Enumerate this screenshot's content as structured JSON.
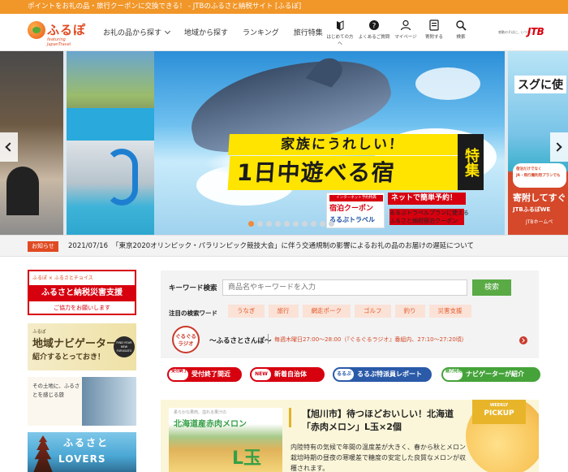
{
  "topbar": {
    "text": "ポイントをお礼の品・旅行クーポンに交換できる！ - JTBのふるさと納税サイト [ふるぽ]"
  },
  "header": {
    "logo": {
      "name": "ふるぽ",
      "sub": "featuring JapanTravel"
    },
    "nav": [
      {
        "label": "お礼の品から探す",
        "dropdown": true
      },
      {
        "label": "地域から探す"
      },
      {
        "label": "ランキング"
      },
      {
        "label": "旅行特集"
      }
    ],
    "utility": [
      {
        "label": "はじめての方へ",
        "icon": "beginner-mark-icon"
      },
      {
        "label": "よくあるご質問",
        "icon": "question-icon"
      },
      {
        "label": "マイページ",
        "icon": "user-icon"
      },
      {
        "label": "寄附する",
        "icon": "donate-icon"
      },
      {
        "label": "検索",
        "icon": "search-icon"
      }
    ],
    "jtb": {
      "tagline": "感動のそばに、いつも。",
      "brand": "JTB"
    }
  },
  "hero": {
    "title_top": "家族にうれしい！",
    "title_main": "1日中遊べる宿",
    "tokushu": "特集",
    "coupon_ribbon": "インターネット予約特典",
    "coupon_title": "宿泊クーポン",
    "coupon_brand": "るるぶトラベル",
    "promo_head": "ネットで簡単予約！",
    "promo_line1": "るるぶトラベルプランに使える",
    "promo_line2": "ふるさと納税宿泊クーポン",
    "dot_count": 10,
    "active_dot": 0,
    "right_peek": {
      "title": "スグに使",
      "sub1": "宿泊だけでなく",
      "sub2": "JR・飛行機利用プランでも",
      "big": "寄附してすぐ",
      "small": "JTBふるぽWE",
      "tiny": "JTBホームペ"
    }
  },
  "news": {
    "label": "お知らせ",
    "date": "2021/07/16",
    "text": "「東京2020オリンピック・パラリンピック競技大会」に伴う交通規制の影響によるお礼の品のお届けの遅延について"
  },
  "left_banners": {
    "disaster": {
      "header": "ふるぽ × ふるさとチョイス",
      "title": "ふるさと納税災害支援",
      "sub": "ご協力をお願いします"
    },
    "navigator": {
      "a": "ふるぽ",
      "b": "地域ナビゲーターが",
      "c": "紹介するとっておき！",
      "badge": "FIND YOUR NEW FURUSATO"
    },
    "article": {
      "text": "その土地に、ふるさとを感じる旅"
    },
    "lovers": {
      "t1": "ふるさと",
      "t2": "LOVERS"
    }
  },
  "search": {
    "keyword_label": "キーワード検索",
    "placeholder": "商品名やキーワードを入力",
    "button": "検索",
    "hot_label": "注目の検索ワード",
    "tags": [
      "うなぎ",
      "旅行",
      "網走ポーク",
      "ゴルフ",
      "釣り",
      "災害支援"
    ],
    "radio": {
      "seal": "ぐるぐる\nラジオ",
      "name": "〜ふるさとさんぽ〜",
      "schedule": "毎週木曜日27:00〜28:00（『ぐるぐるラジオ』番組内、27:10〜27:20頃）"
    }
  },
  "pills": [
    {
      "tag": "受付終了",
      "label": "受付終了間近"
    },
    {
      "tag": "NEW",
      "label": "新着自治体"
    },
    {
      "tag": "るるぶ",
      "label": "るるぶ特派員レポート"
    },
    {
      "tag": "魅力発見",
      "label": "ナビゲーターが紹介"
    }
  ],
  "feature": {
    "img_caption": "柔らかな果肉、溢れる果汁の",
    "img_title": "北海道産赤肉メロン",
    "img_badge": "L玉",
    "title": "【旭川市】待つほどおいしい！北海道「赤肉メロン」L玉×2個",
    "desc": "内陸特有の気候で年間の温度差が大きく、春から秋とメロン栽培時期の昼夜の寒暖差で糖度の安定した良質なメロンが収穫されます。",
    "weekly": "WEEKLY",
    "pickup": "PICKUP"
  }
}
